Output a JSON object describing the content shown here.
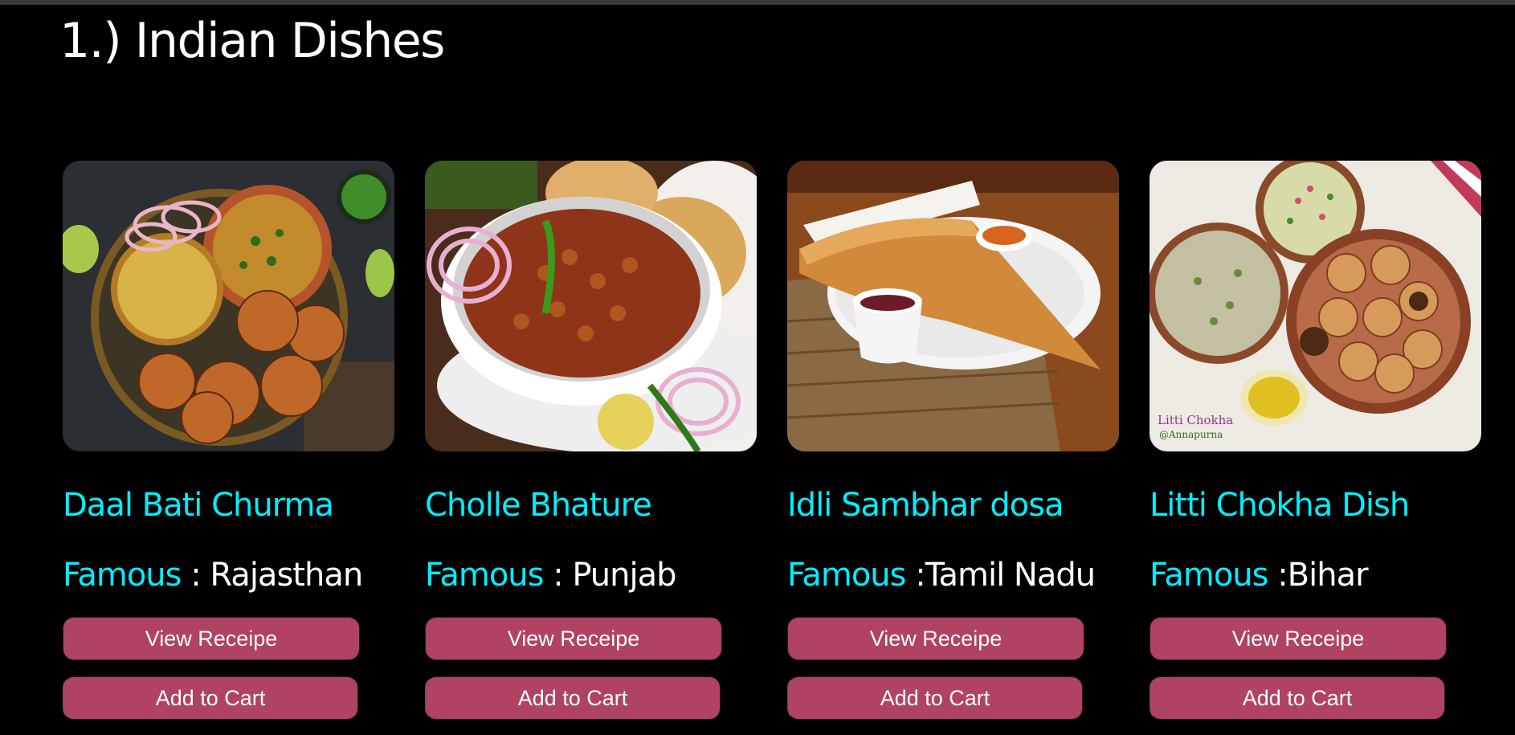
{
  "section": {
    "title": "1.) Indian Dishes"
  },
  "dishes": [
    {
      "name": "Daal Bati Churma",
      "famous_label": "Famous",
      "famous_value": " : Rajasthan",
      "view_label": "View Receipe",
      "cart_label": "Add to Cart",
      "image": "daal-bati-churma-photo"
    },
    {
      "name": "Cholle Bhature",
      "famous_label": "Famous",
      "famous_value": " : Punjab",
      "view_label": "View Receipe",
      "cart_label": "Add to Cart",
      "image": "cholle-bhature-photo"
    },
    {
      "name": "Idli Sambhar dosa",
      "famous_label": "Famous",
      "famous_value": " :Tamil Nadu",
      "view_label": "View Receipe",
      "cart_label": "Add to Cart",
      "image": "idli-sambhar-dosa-photo"
    },
    {
      "name": "Litti Chokha Dish",
      "famous_label": "Famous",
      "famous_value": " :Bihar",
      "view_label": "View Receipe",
      "cart_label": "Add to Cart",
      "image": "litti-chokha-photo",
      "image_caption": "Litti Chokha",
      "image_credit": "@Annapurna"
    }
  ],
  "colors": {
    "background": "#000000",
    "accent_cyan": "#00f0ff",
    "button": "#b04262",
    "text": "#ffffff"
  }
}
